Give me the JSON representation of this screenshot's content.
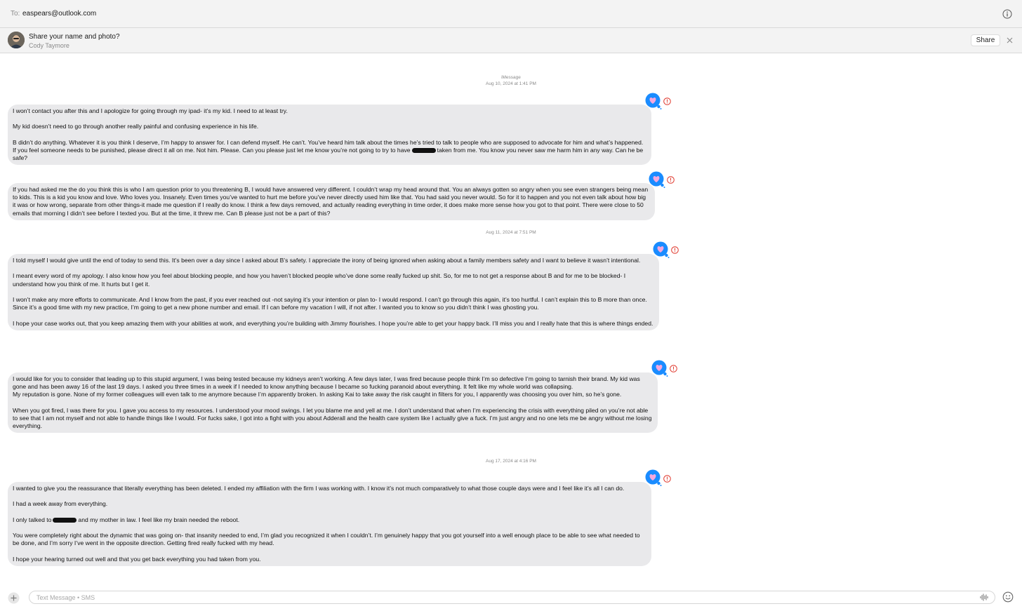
{
  "header": {
    "to_label": "To:",
    "recipient": "easpears@outlook.com",
    "info_icon": "info-icon"
  },
  "share_banner": {
    "title": "Share your name and photo?",
    "name": "Cody Taymore",
    "share_label": "Share",
    "close_icon": "close-icon"
  },
  "conversation": {
    "service_label": "iMessage",
    "stamps": {
      "aug10": "Aug 10, 2024 at 1:41 PM",
      "aug11": "Aug 11, 2024 at 7:51 PM",
      "aug17": "Aug 17, 2024 at 4:16 PM"
    },
    "messages": [
      {
        "paragraphs": [
          "I won’t contact you after this and I apologize for going through my ipad- it’s my kid. I need to at least try.",
          "My kid doesn’t need to go through another really painful and confusing experience in his life.",
          "B didn’t do anything. Whatever it is you think I deserve, I’m happy to answer for. I can defend myself. He can’t. You’ve heard him talk about the times he’s tried to talk to people who are supposed to advocate for him and what’s happened. If you feel someone needs to be punished, please direct it all on me. Not him. Please. Can you please just let me know you’re not going to try to have",
          "taken from me. You know you never saw me harm him in any way. Can he be safe?"
        ]
      },
      {
        "paragraphs": [
          "If you had asked me the do you think this is who I am question prior to you threatening B, I would have answered very different. I couldn’t wrap my head around that.  You an always gotten so angry when you see even strangers being mean to kids. This is a kid you know and love. Who loves you. Insanely. Even times you’ve wanted to hurt me before you’ve never directly used him like that. You had said you never would. So for it to happen and you not even talk about how big it was or how wrong, separate from other things-it made me question if I really do know. I think a few days removed, and actually reading everything in time order, it does make more sense how you got to that point. There were close to 50 emails that morning I didn’t see before I texted you. But at the time, it threw me. Can B please just not be a part of this?"
        ]
      },
      {
        "paragraphs": [
          "I told myself I would give until the end of today to send this. It’s been over a day since I asked about B’s safety. I appreciate the irony of being ignored when asking about a family members safety and I want to believe it wasn’t intentional.",
          "I meant every word of my apology. I also know how you feel about blocking people, and how you haven’t blocked people who’ve done some really fucked up shit. So, for me to not get a response about B and for me to be blocked- I understand how you think of me. It hurts but I get it.",
          "I won’t make any more efforts to communicate. And I know from the past, if you ever reached out -not saying it’s your intention or plan to- I would respond. I can’t go through this again, it’s too hurtful. I can’t explain this to B more than once. Since it’s a good time with my new practice, I’m going to get a new phone number and email. If I can before my vacation I will, if not after. I wanted you to know so you didn’t think I was ghosting you.",
          "I hope your case works out, that you keep amazing them with your abilities at work, and everything you’re building with Jimmy flourishes. I hope you’re able to get your happy back. I’ll miss you and I really hate that this is where things ended."
        ]
      },
      {
        "paragraphs": [
          "I would like for you to consider that leading up to this stupid argument, I was being tested because my kidneys aren’t working. A few days later, I was fired because people think I’m so defective I’m going to tarnish their brand. My kid was gone and has been away 16 of the last 19 days. I asked you three times in a week if I needed to know anything because I became so fucking paranoid about everything. It felt like my whole world was collapsing.",
          "My reputation is gone. None of my former colleagues will even talk to me anymore because I’m apparently broken. In asking Kai to take away the risk caught in filters for you, I apparently was choosing you over him, so he’s gone.",
          "When you got fired, I was there for you. I gave you access to my resources. I understood your mood swings. I let you blame me and yell at me. I don’t understand that when I’m experiencing the crisis with everything piled on you’re not able to see that I am not myself and not able to handle things like I would. For fucks sake, I got into a fight with you about Adderall and the health care system like I actually give a fuck. I’m just angry and no one lets me be angry without me losing everything."
        ]
      },
      {
        "paragraphs": [
          "I wanted to give you the reassurance that literally everything has been deleted. I ended my affiliation with the firm I was working with. I know it’s not much comparatively to what those couple days were and I feel like it’s all I can do.",
          "I had a week away from everything.",
          "I only talked to",
          "and my mother in law. I feel like my brain needed the reboot.",
          "You were completely right about the dynamic that was going on- that insanity needed to end, I’m glad you recognized it when I couldn’t. I’m genuinely happy that you got yourself into a well enough place to be able to see what needed to be done, and I’m sorry I’ve went in the opposite direction. Getting fired really fucked with my head.",
          "I hope your hearing turned out well and that you get back everything you had taken from you."
        ]
      }
    ],
    "tapback_icon": "heart-tapback-icon",
    "error_icon": "not-delivered-icon"
  },
  "composer": {
    "placeholder": "Text Message • SMS",
    "plus_icon": "plus-icon",
    "audio_icon": "audio-waveform-icon",
    "emoji_icon": "emoji-icon"
  },
  "colors": {
    "bubble": "#e9e9eb",
    "tapback": "#1a8cff",
    "error": "#e03a2f",
    "bar": "#f3f3f3"
  }
}
